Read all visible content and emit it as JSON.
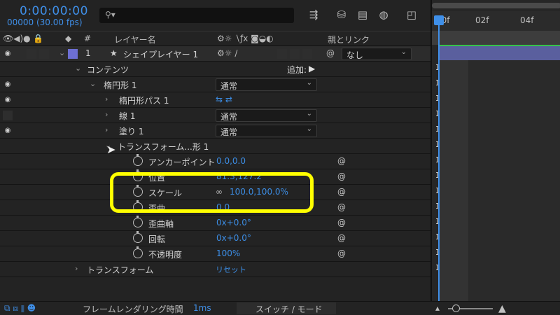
{
  "header": {
    "timecode": "0:00:00:00",
    "frame_info": "00000 (30.00 fps)",
    "search_icon": "search-icon"
  },
  "columns": {
    "layer_name": "レイヤー名",
    "hash": "#",
    "parent_link": "親とリンク"
  },
  "layer": {
    "number": "1",
    "name": "シェイプレイヤー 1",
    "parent_value": "なし",
    "label_color": "#6d6fd3"
  },
  "rows": {
    "contents": "コンテンツ",
    "add_label": "追加:",
    "ellipse": "楕円形 1",
    "ellipse_mode": "通常",
    "ellipse_path": "楕円形パス 1",
    "stroke": "線 1",
    "stroke_mode": "通常",
    "fill": "塗り 1",
    "fill_mode": "通常",
    "transform_group": "トランスフォーム...形 1",
    "anchor": "アンカーポイント",
    "anchor_val": "0.0,0.0",
    "position": "位置",
    "position_val": "81.3,127.2",
    "scale": "スケール",
    "scale_val": "100.0,100.0%",
    "skew": "歪曲",
    "skew_val": "0.0",
    "skew_axis": "歪曲軸",
    "skew_axis_val": "0x+0.0°",
    "rotation": "回転",
    "rotation_val": "0x+0.0°",
    "opacity": "不透明度",
    "opacity_val": "100%",
    "layer_transform": "トランスフォーム",
    "reset": "リセット"
  },
  "timeline": {
    "tick0": "00f",
    "tick1": "02f",
    "tick2": "04f"
  },
  "footer": {
    "render_label": "フレームレンダリング時間",
    "render_time": "1ms",
    "switch_mode": "スイッチ / モード"
  },
  "colors": {
    "accent": "#3f8fe8",
    "highlight": "#ffff00",
    "layer_bar": "#5a5f9e",
    "green_line": "#36c34a"
  }
}
